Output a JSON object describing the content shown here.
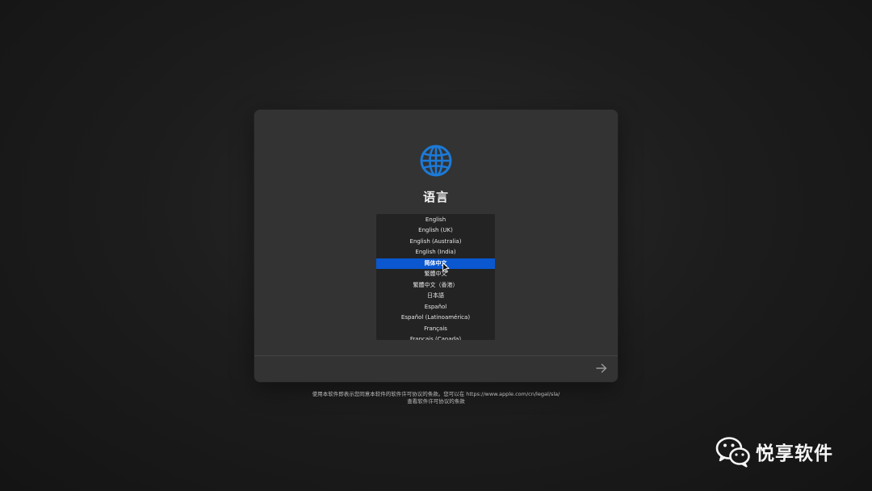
{
  "colors": {
    "accent": "#0a57d0",
    "globe_blue": "#1c7ad8",
    "panel_bg": "#333333",
    "list_bg": "#232323"
  },
  "setup": {
    "title": "语言",
    "globe_icon": "globe-icon",
    "next_icon": "arrow-right-icon",
    "languages": [
      {
        "label": "English",
        "selected": false
      },
      {
        "label": "English (UK)",
        "selected": false
      },
      {
        "label": "English (Australia)",
        "selected": false
      },
      {
        "label": "English (India)",
        "selected": false
      },
      {
        "label": "简体中文",
        "selected": true
      },
      {
        "label": "繁體中文",
        "selected": false
      },
      {
        "label": "繁體中文（香港）",
        "selected": false
      },
      {
        "label": "日本語",
        "selected": false
      },
      {
        "label": "Español",
        "selected": false
      },
      {
        "label": "Español (Latinoamérica)",
        "selected": false
      },
      {
        "label": "Français",
        "selected": false
      },
      {
        "label": "Français (Canada)",
        "selected": false
      }
    ]
  },
  "license": {
    "line1": "使用本软件即表示您同意本软件的软件许可协议的条款。您可以在 https://www.apple.com/cn/legal/sla/",
    "line2": "查看软件许可协议的条款"
  },
  "watermark": {
    "icon": "wechat-icon",
    "text": "悦享软件"
  }
}
